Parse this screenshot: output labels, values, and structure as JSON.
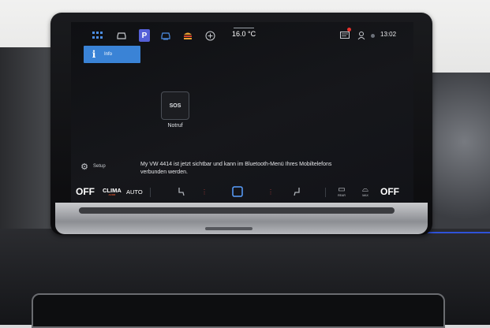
{
  "topbar": {
    "icons": [
      "apps-grid-icon",
      "car-icon",
      "parking-icon",
      "assist-icon",
      "food-icon",
      "add-icon",
      "notification-icon",
      "user-icon"
    ],
    "parking_label": "P",
    "temperature": "16.0 °C",
    "time": "13:02"
  },
  "info_button": {
    "label": "Info",
    "icon_label": "i"
  },
  "sos_tile": {
    "icon_text": "SOS",
    "label": "Notruf"
  },
  "setup": {
    "label": "Setup"
  },
  "message": "My VW 4414 ist jetzt sichtbar und kann im Bluetooth-Menü Ihres Mobiltelefons verbunden werden.",
  "bottombar": {
    "off_left": "OFF",
    "clima": "CLIMA",
    "clima_sub": "ACOR",
    "auto": "AUTO",
    "rear_label": "REAR",
    "max_label": "MAX",
    "off_right": "OFF"
  },
  "colors": {
    "accent_blue": "#3a83d6",
    "notification_red": "#e8322c",
    "heat_red": "#a8383a",
    "home_blue": "#5aa0ff"
  }
}
